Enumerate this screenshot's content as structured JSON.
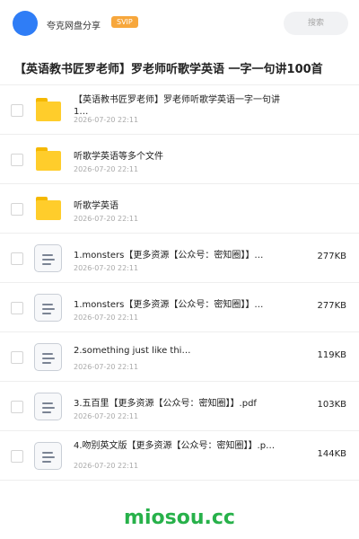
{
  "header": {
    "app_name": "夸克网盘分享",
    "badge": "SVIP",
    "search_placeholder": "搜索"
  },
  "title": "【英语教书匠罗老师】罗老师听歌学英语 一字一句讲100首",
  "colors": {
    "avatar": "#2f7df6",
    "badge": "#f7a73c",
    "folder": "#ffcd2b",
    "watermark": "#27b14a"
  },
  "files": [
    {
      "type": "folder",
      "name": "【英语教书匠罗老师】罗老师听歌学英语一字一句讲1…",
      "date": "2026-07-20 22:11",
      "size": ""
    },
    {
      "type": "folder",
      "name": "听歌学英语等多个文件",
      "date": "2026-07-20 22:11",
      "size": ""
    },
    {
      "type": "folder",
      "name": "听歌学英语",
      "date": "2026-07-20 22:11",
      "size": ""
    },
    {
      "type": "doc",
      "name": "1.monsters【更多资源【公众号：密知圈】】…",
      "date": "2026-07-20 22:11",
      "size": "277KB"
    },
    {
      "type": "doc",
      "name": "1.monsters【更多资源【公众号：密知圈】】…",
      "date": "2026-07-20 22:11",
      "size": "277KB"
    },
    {
      "type": "doc",
      "name": "2.something just like thi…",
      "date": "2026-07-20 22:11",
      "size": "119KB"
    },
    {
      "type": "doc",
      "name": "3.五百里【更多资源【公众号：密知圈】】.pdf",
      "date": "2026-07-20 22:11",
      "size": "103KB"
    },
    {
      "type": "doc",
      "name": "4.吻别英文版【更多资源【公众号：密知圈】】.p…",
      "date": "2026-07-20 22:11",
      "size": "144KB"
    }
  ],
  "watermark": "miosou.cc"
}
